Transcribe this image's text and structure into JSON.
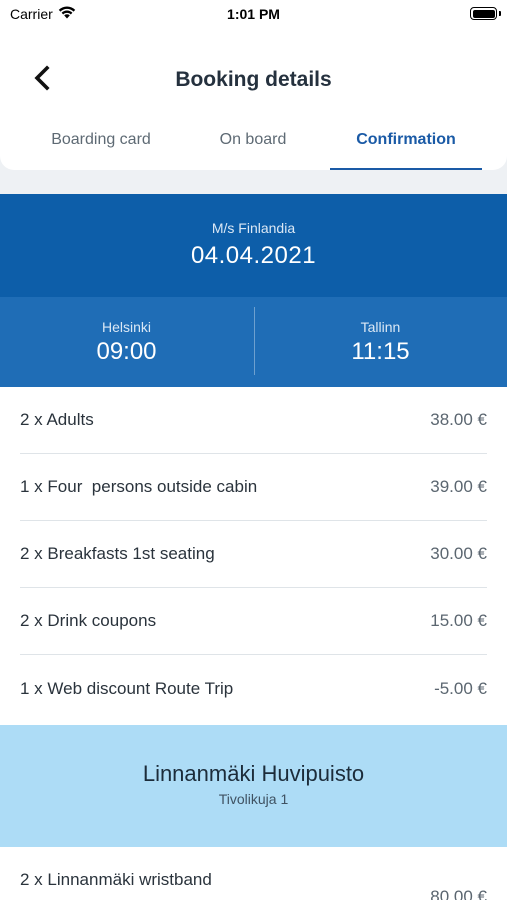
{
  "status_bar": {
    "carrier": "Carrier",
    "time": "1:01 PM",
    "battery_level": 1.0
  },
  "header": {
    "title": "Booking details",
    "back_icon": "chevron-left-icon"
  },
  "tabs": [
    {
      "label": "Boarding card",
      "active": false
    },
    {
      "label": "On board",
      "active": false
    },
    {
      "label": "Confirmation",
      "active": true
    }
  ],
  "ship": {
    "name": "M/s Finlandia",
    "date": "04.04.2021"
  },
  "route": {
    "departure_city": "Helsinki",
    "departure_time": "09:00",
    "arrival_city": "Tallinn",
    "arrival_time": "11:15"
  },
  "items": [
    {
      "label": "2 x Adults",
      "price": "38.00 €"
    },
    {
      "label": "1 x Four  persons outside cabin",
      "price": "39.00 €"
    },
    {
      "label": "2 x Breakfasts 1st seating",
      "price": "30.00 €"
    },
    {
      "label": "2 x Drink coupons",
      "price": "15.00 €"
    },
    {
      "label": "1 x Web discount Route Trip",
      "price": "-5.00 €"
    }
  ],
  "venue": {
    "name": "Linnanmäki Huvipuisto",
    "address": "Tivolikuja 1"
  },
  "venue_items": [
    {
      "label": "2 x Linnanmäki wristband",
      "price": "80.00 €"
    }
  ],
  "colors": {
    "primary_blue": "#0d5ea9",
    "route_blue": "#1f6db6",
    "venue_light_blue": "#addcf6",
    "active_tab": "#1a5aa6"
  }
}
